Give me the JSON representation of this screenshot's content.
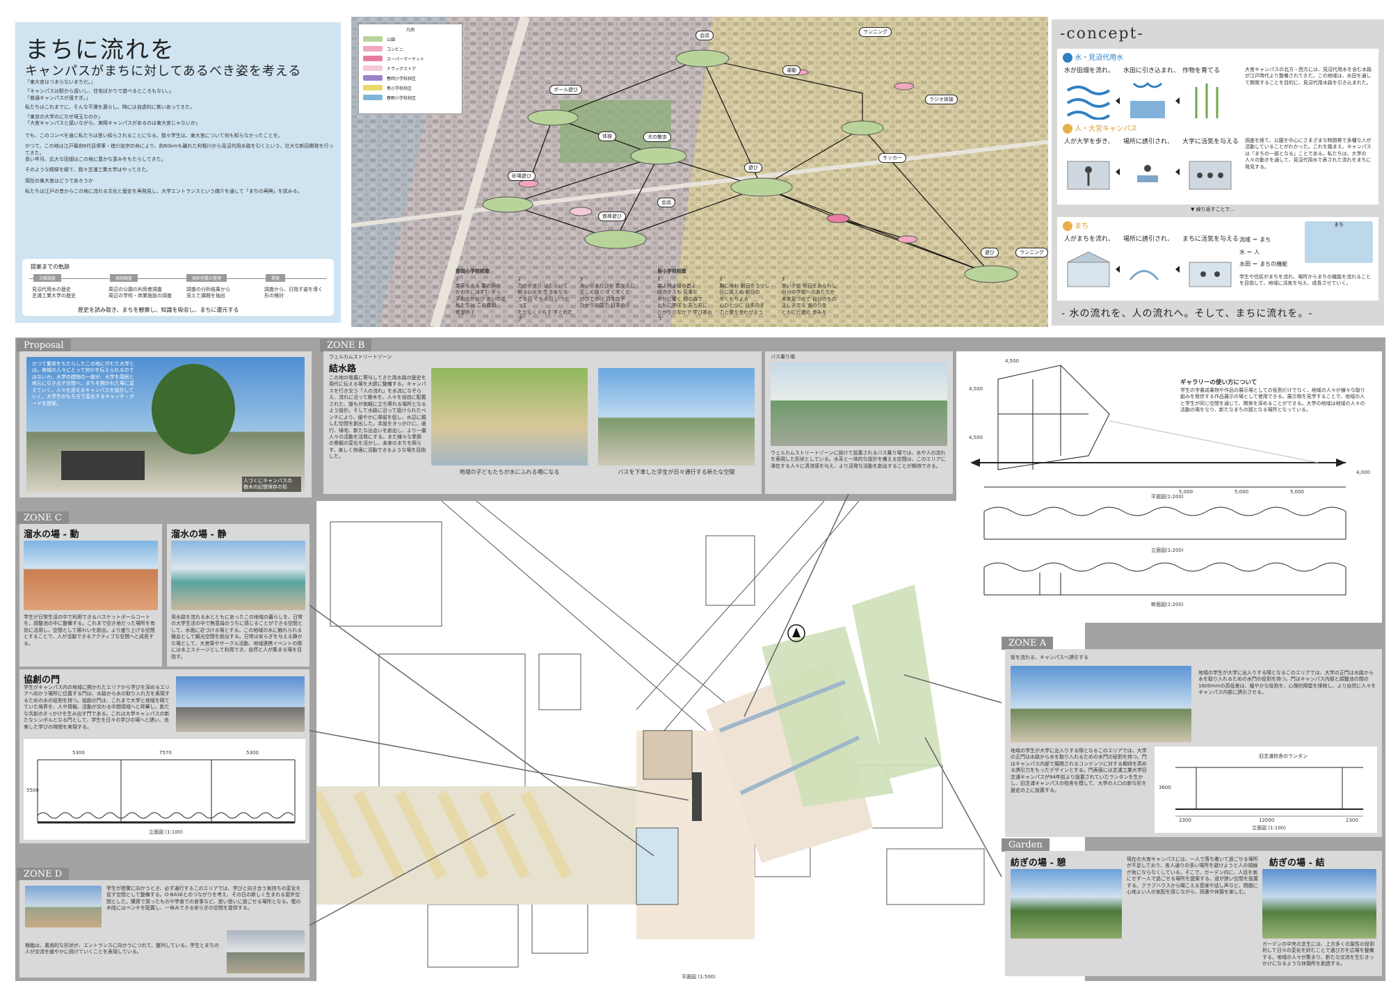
{
  "header": {
    "title": "まちに流れを",
    "subtitle": "キャンパスがまちに対してあるべき姿を考える",
    "intro_lines": [
      "「東大宮はつまらないまちだ。」",
      "「キャンパスは駅から遠いし、住宅ばかりで遊べるところもない。」",
      "「普通キャンパスが遠すぎ。」",
      "私たちはこれまでに、そんな不満を漏らし、時には自虐的に笑いあってきた。",
      "「東京の大学のになぜ埼玉なのか」",
      "「大宮キャンパスと謳いながら、実際キャンパスがあるのは東大宮じゃないか」",
      "でも、このコンペを通じ私たちは思い知らされることになる。我々学生は、東大宮について何も知らなかったことを。",
      "かつて、この地は江戸幕府8代目将軍・徳川吉宗の命により、約60kmも離れた利根川から見沼代用水路を引くという、壮大な新田開発を行ってきた。",
      "長い年月、広大な田畑はこの地に豊かな恵みをもたらしてきた。",
      "そのような経緯を経て、我々芝浦工業大学はやってきた。",
      "現在の東大宮はどうであろうか",
      "私たちは江戸の昔からこの地に流れる文化と歴史を再発見し、大学エントランスという媒介を通して「まちの再興」を試みる。"
    ],
    "process_title": "提案までの軌跡",
    "process_steps": [
      "文献調査",
      "現地調査",
      "現状把握の整理",
      "提案"
    ],
    "process_notes": [
      "見沼代用水の歴史\n芝浦工業大学の歴史",
      "周辺の公園の利用者調査\n周辺の学校・商業施設の調査",
      "調査の分析結果から\n見えた課題を抽出",
      "調査から、日指す姿を導く\n形の検討"
    ],
    "process_caption": "歴史を読み取き、まちを観察し、知識を吸収し、まちに還元する"
  },
  "map": {
    "legend_title": "凡例",
    "legend": [
      {
        "label": "公園",
        "color": "#b9d49a"
      },
      {
        "label": "コンビニ",
        "color": "#f2a7c0"
      },
      {
        "label": "スーパーマーケット",
        "color": "#e87aa2"
      },
      {
        "label": "ドラッグストア",
        "color": "#f4c9d6"
      },
      {
        "label": "春岡小学校校区",
        "color": "#9a83c9"
      },
      {
        "label": "島小学校校区",
        "color": "#e9d86a"
      },
      {
        "label": "春野小学校校区",
        "color": "#7fb6d8"
      }
    ],
    "activities": [
      "会話",
      "ランニング",
      "ボール遊び",
      "ラジオ体操",
      "体操",
      "犬の散歩",
      "遊び",
      "運動",
      "サッカー",
      "砂場遊び",
      "鉄棒遊び",
      "会話",
      "遊び",
      "ランニング"
    ],
    "school1_title": "春岡小学校校歌",
    "school2_title": "島小学校校歌",
    "school1_verses": [
      "1\n若草もえる 春の野の\nかおりにはずむ 子ら\n平和のかおり あいの花\n私たちは この春岡\n希望の子",
      "2\n力のかぎり はたらいて\n明るい光を 生きるなら\nてる日 くもる日 いつだって\nただしくくらす すぐれた子",
      "3\nあいのまなびや 若なえに\n正しく強く すくすくと\nのびてゆけ 日本の子\nひかりの国で 日本の子"
    ],
    "school2_verses": [
      "1\n森よ林よ緑の首よ\n緑のクスも 見事な\nゆかに響く 緑の森で\nともに学ぼう 友と共に\nひかりのなかで 学びあおう",
      "2\n胸に味わ 朝日をうつし\n目に見えぬ 朝日の\nゆくもちよる\n心ひとつに 日本の子\n力と愛を合わせよう",
      "3\n赤い夕空 明日をあらわし\n自分の学校へのあたたか\n未来見つめて 自分のもの\n正しきでる 道のりを\nともに行進の 歩みを"
    ]
  },
  "concept": {
    "title": "-concept-",
    "water_heading": "水・見沼代用水",
    "water_steps": [
      "水が田畑を流れ、",
      "水田に引き込まれ、",
      "作物を育てる"
    ],
    "water_text": "大宮キャンパスの北方・西方には、見沼代用水を含む水路が江戸時代より整備されてきた。この地域は、水田を通して開発することを目的に、見沼代用水路を引き込まれた。",
    "people_heading": "人・大宮キャンパス",
    "people_steps": [
      "人が大学を歩き、",
      "場所に誘引され、",
      "大学に活気を与える"
    ],
    "people_text": "調査を経て、公園を中心にさまざまな時間帯で多種な人が活動していることがわかった。これを踏まえ、キャンパスは「まちの一部となる」ことである。私たちは、大学の人々の動きを通して、見沼代用水で表された流れをまちに発見する。",
    "bridge_label": "繰り返すことで…",
    "town_heading": "まち",
    "town_steps": [
      "人がまちを流れ、",
      "場所に誘引され、",
      "まちに活気を与える"
    ],
    "equations": [
      "流域 ＝ まち",
      "水 ＝ 人",
      "水田 ＝ まちの機能"
    ],
    "town_text": "学生や住民がまちを流れ、場所からまちの機能を流れることを目指して、地域に活気を与え、成長させていく。",
    "diagram_label": "まち",
    "slogan": "- 水の流れを、人の流れへ。そして、まちに流れを。-"
  },
  "proposal": {
    "tab": "Proposal",
    "text": "かつて繁栄をもたらしたこの地に佇むた大学とは。地域の人々にとって何かを伝えられるのではないか。大学の建物の一部が、大学を周囲と地元に引き出す空間へ、まちを開かれた場に変えていく、人々を迎えるキャンパスを設計していく。大学生のもち方で変化するキャッチ・ボードを提案。",
    "caption": "人づくにキャンパスの\n樹木の記憶保存の形"
  },
  "zone_b": {
    "tab": "ZONE B",
    "subtitle": "ウェルカムストリートゾーン",
    "title": "結水路",
    "text": "この地の発展に寄与してきた用水路の歴史を現代に伝える場を大胆に整備する。キャンパスを行き交う「人の流れ」を水流になぞらえ、流れに沿って樹木を、人々を自由に配置された、誰もが気軽に立ち寄れる場所となるよう設計。そして水路に沿って設けられたベンチにより、緩やかに滞留を促し、水辺に親しむ空間を創出した。本設をきっかけに、通行、帰宅、新たな出会いを創出し、より一層人々の活動を活発にする。また様々な季節の景観の変化を活かし、未来のまちを照らす、楽しく快適に活動できるような場を目指した。",
    "caption1": "地域の子どもたちが水にふれる場になる",
    "caption2": "バスを下車した学生が日々通行する新たな空間",
    "bus_label": "バス乗り場",
    "bus_text": "ウェルカムストリートゾーンに設けて設置されるバス乗り場では、水や人の流れを表現した形状としている。水系と一体的な設計を備える空間は、このエリアに滞在する人々に清涼感を与え、より活発な活動を創出することが期待できる。",
    "gallery_title": "ギャラリーの使い方について",
    "gallery_text": "学生の字書成果物や作品の展示場としての役割だけでなく、地域の人々が様々な取り組みを発信する作品展示の場として使用できる。展示物を見学することで、地域の人と学生が同じ空間を通じて、関係を深めることができる。大学の地域は地域の人々の活動の場をなり、新たなまちの顔となる場所となっている。",
    "dims": [
      "4,500",
      "4,500",
      "4,000",
      "4,500",
      "5,000",
      "5,000",
      "5,000"
    ],
    "plan_label": "平面図(1:200)",
    "elev_label": "立面図(1:200)",
    "sect_label": "断面図(1:200)"
  },
  "zone_c": {
    "tab": "ZONE C",
    "title_left": "溜水の場 - 動",
    "title_right": "溜水の場 - 静",
    "text_left": "学生が日常生活の中で利用できるバスケットボールコートを、調整池の中に整備する。これまで空き地だった場所を有効に活用し、空間として賑わいを創出。より盛り上げる空間とすることで、人が活動できるアクティブな空間へと成長する。",
    "text_right": "用水路を流れる水とともにあったこの地域の暮らしを、日常の大学生活の中で無意識のうちに感じることができる空間として、水面に近づける場とする。この地域の水に触れられる機会として観光空間を創出する。日常は安らぎを与える静かな場として、大宮祭やサークル活動、地域連携イベントの際には水上ステージとして利用でき、自然と人が集まる場を目指す。",
    "gate_title": "協創の門",
    "gate_text": "学生がキャンパス内の地域に開かれたエリアから学びを深めるエリアへ向かう場所に位置する門は、水路から水の取り入れ方を表現するための水の役割を持つ。協創の門は、これまで大学と地域を隔てていた境界を、人や情報、活動が交わる中間領域へと昇華し、新たな共創のきっかけを生み出す門である。これは大学キャンパスの新たなシンボルとなる門として、学生を日々の学びの場へと誘い、充実した学びの時間を実現する。",
    "dims": [
      "5300",
      "7570",
      "5300"
    ],
    "height": "5500",
    "elev_label": "立面図 (1:100)"
  },
  "zone_d": {
    "tab": "ZONE D",
    "text1": "学生が授業に向かうとき、必ず通行するこのエリアでは、学びと向き合う気持ちの変化を促す空間として整備する。O-BASEとのつながりを考え、その日の新しく生まれる屋外空間とした。購買で買ったものや学食での食事など、思い思いに過ごせる場所となる。樫の木陰にはベンチを配置し、一休みできる安らぎの空間を提供する。",
    "text2": "樹脂は、風雨的な形状が、エントランスに向かうにつれて、整列している。学生とまちの人が交流を緩やかに続けていくことを表現している。"
  },
  "zone_a": {
    "tab": "ZONE A",
    "subtitle": "街を流れる、キャンパスへ誘引する",
    "text1": "地域の学生が大学に出入りする際となるこのエリアでは、大学の正門は水路から水を取り入れるための水門の役割を持つ。門はキャンパス内部と調整池の間の1600mmの高低差は、緩やかな役割を、心理的障壁を排除し、より自然に人々をキャンパス内部に誘引させる。",
    "text2": "地域の学生が大学に出入りする際となるこのエリアでは、大学の正門は水路から水を取り入れるための水門の役割を持つ。門はキャンパス内部で展開されるコンテンツに対する期待を高める誘引力をもったデザインとする。門表面には芝浦工業大学旧芝浦キャンパスが94年前より設置されていたランタンを生かし、旧芝浦キャンパスの校舎を模して、大学の人口の新な形を歴史の上に設置する。",
    "lantern_label": "旧芝浦校舎のランタン",
    "dims": [
      "2300",
      "12000",
      "2300"
    ],
    "height": "3600",
    "elev_label": "立面図 (1:100)"
  },
  "garden": {
    "tab": "Garden",
    "title_left": "紡ぎの場 - 憩",
    "title_right": "紡ぎの場 - 結",
    "text_left": "現在の大宮キャンパスには、一人で落ち着いて過ごせる場所が不足しており、各人通りの多い場所を避けようと人の視線が気にならなくしている。そこで、ガーデン内に、人目を気にせず一人で過ごせる場所を提案する。道が狭い空間を設置する。クラブハウスから聞こえる音楽や話し声など、問題に心地よい人の気配を感じながら、読書や休憩を楽しむ。",
    "text_right": "ガーデンの中央の芝生には、上方多くの属性の役割利して日々の変化を好むことで選び方を広場を整備する。地域の人々が集まり、新たな交流を生むきっかけになるような休憩所を創造する。"
  },
  "siteplan": {
    "label": "平面図 (1:500)"
  }
}
